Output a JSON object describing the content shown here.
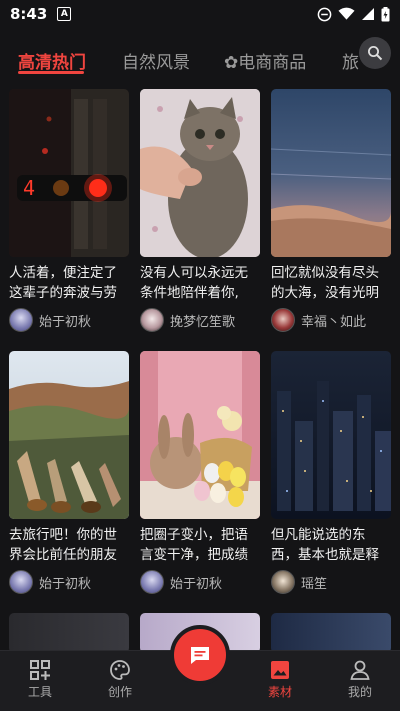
{
  "status_bar": {
    "time": "8:43",
    "app_badge": "A"
  },
  "tabs": [
    {
      "label": "高清热门",
      "active": true
    },
    {
      "label": "自然风景"
    },
    {
      "label": "✿电商商品"
    },
    {
      "label": "旅"
    }
  ],
  "cards": [
    {
      "title": "人活着，便注定了这辈子的奔波与劳",
      "author": "始于初秋"
    },
    {
      "title": "没有人可以永远无条件地陪伴着你,",
      "author": "挽梦忆笙歌"
    },
    {
      "title": "回忆就似没有尽头的大海，没有光明",
      "author": "幸福丶如此"
    },
    {
      "title": "去旅行吧！你的世界会比前任的朋友",
      "author": "始于初秋"
    },
    {
      "title": "把圈子变小，把语言变干净，把成绩",
      "author": "始于初秋"
    },
    {
      "title": "但凡能说选的东西，基本也就是释",
      "author": "瑶笙"
    }
  ],
  "bottom_nav": {
    "tools": "工具",
    "create": "创作",
    "material": "素材",
    "mine": "我的"
  },
  "colors": {
    "accent": "#f0453f",
    "background": "#141416"
  }
}
